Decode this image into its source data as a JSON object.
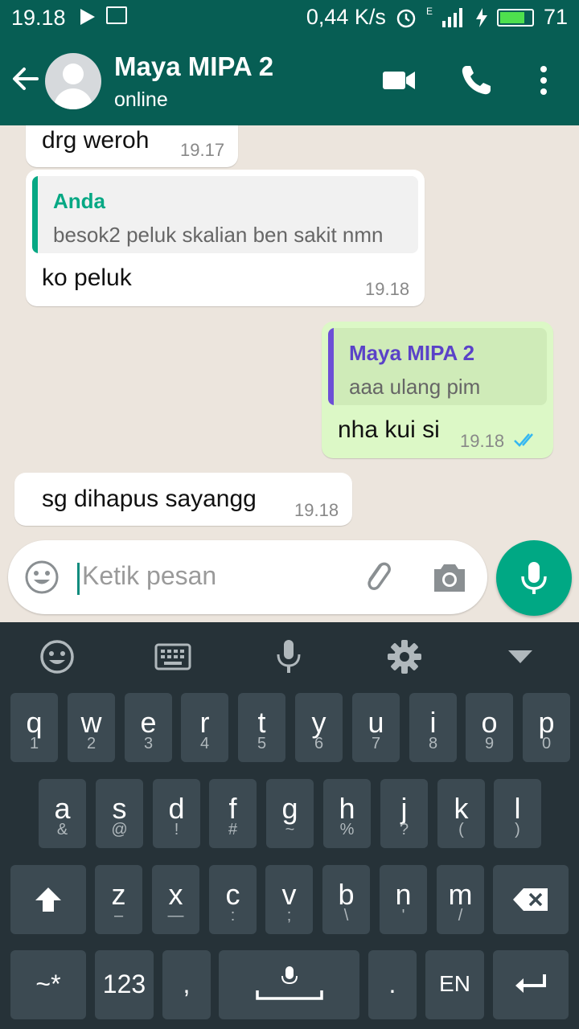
{
  "status_bar": {
    "time": "19.18",
    "net_speed": "0,44 K/s",
    "signal_label": "E",
    "battery": "71"
  },
  "header": {
    "contact_name": "Maya MIPA 2",
    "contact_status": "online"
  },
  "messages": [
    {
      "direction": "in",
      "text": "drg weroh",
      "time": "19.17"
    },
    {
      "direction": "in",
      "quote_name": "Anda",
      "quote_text": "besok2 peluk skalian ben sakit nmn",
      "text": "ko peluk",
      "time": "19.18"
    },
    {
      "direction": "out",
      "quote_name": "Maya MIPA 2",
      "quote_text": "aaa ulang pim",
      "text": "nha kui si",
      "time": "19.18",
      "status": "read-double-check"
    },
    {
      "direction": "in",
      "text": "sg dihapus sayangg",
      "time": "19.18"
    }
  ],
  "composer": {
    "placeholder": "Ketik pesan"
  },
  "keyboard": {
    "row1": [
      {
        "main": "q",
        "sub": "1"
      },
      {
        "main": "w",
        "sub": "2"
      },
      {
        "main": "e",
        "sub": "3"
      },
      {
        "main": "r",
        "sub": "4"
      },
      {
        "main": "t",
        "sub": "5"
      },
      {
        "main": "y",
        "sub": "6"
      },
      {
        "main": "u",
        "sub": "7"
      },
      {
        "main": "i",
        "sub": "8"
      },
      {
        "main": "o",
        "sub": "9"
      },
      {
        "main": "p",
        "sub": "0"
      }
    ],
    "row2": [
      {
        "main": "a",
        "sub": "&"
      },
      {
        "main": "s",
        "sub": "@"
      },
      {
        "main": "d",
        "sub": "!"
      },
      {
        "main": "f",
        "sub": "#"
      },
      {
        "main": "g",
        "sub": "~"
      },
      {
        "main": "h",
        "sub": "%"
      },
      {
        "main": "j",
        "sub": "?"
      },
      {
        "main": "k",
        "sub": "("
      },
      {
        "main": "l",
        "sub": ")"
      }
    ],
    "row3": [
      {
        "main": "z",
        "sub": "–"
      },
      {
        "main": "x",
        "sub": "—"
      },
      {
        "main": "c",
        "sub": ":"
      },
      {
        "main": "v",
        "sub": ";"
      },
      {
        "main": "b",
        "sub": "\\"
      },
      {
        "main": "n",
        "sub": "'"
      },
      {
        "main": "m",
        "sub": "/"
      }
    ],
    "symbols_key": "~*",
    "numbers_key": "123",
    "comma_key": ",",
    "period_key": ".",
    "language_key": "EN"
  },
  "colors": {
    "header": "#075e54",
    "outgoing_bubble": "#dcf8c6",
    "incoming_bubble": "#ffffff",
    "mic_button": "#00a884",
    "quote_bar_anda": "#06a884",
    "quote_bar_contact": "#6c4fd6",
    "keyboard_bg": "#263238",
    "key_bg": "#3c4a52"
  }
}
